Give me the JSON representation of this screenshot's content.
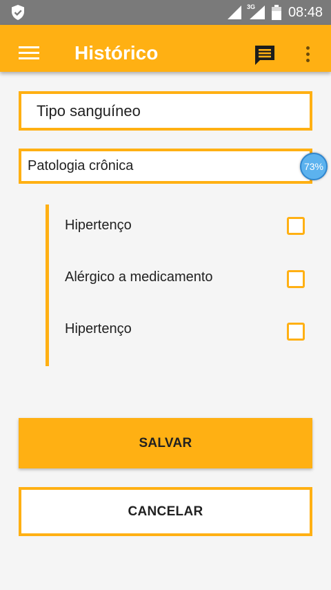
{
  "status_bar": {
    "network_type": "3G",
    "time": "08:48"
  },
  "app_bar": {
    "title": "Histórico",
    "icons": [
      "menu-icon",
      "chat-icon",
      "more-vert-icon"
    ]
  },
  "form": {
    "blood_type_placeholder": "Tipo sanguíneo",
    "chronic_pathology_label": "Patologia crônica",
    "progress_badge": "73%",
    "conditions": [
      {
        "label": "Hipertenço",
        "checked": false
      },
      {
        "label": "Alérgico a medicamento",
        "checked": false
      },
      {
        "label": "Hipertenço",
        "checked": false
      }
    ]
  },
  "actions": {
    "save_label": "SALVAR",
    "cancel_label": "CANCELAR"
  },
  "colors": {
    "accent": "#ffb013",
    "status_bar": "#7a7a7a",
    "background": "#f5f5f5",
    "badge": "#5cb2ee"
  }
}
